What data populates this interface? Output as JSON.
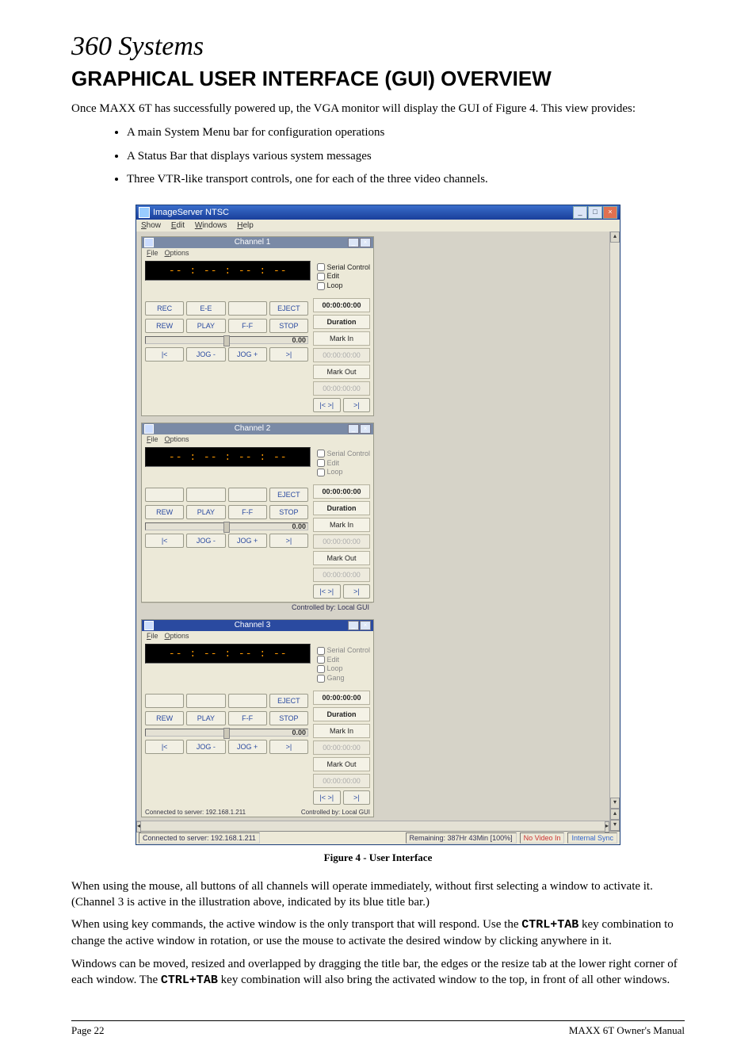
{
  "logo_text": "360 Systems",
  "heading": "GRAPHICAL USER INTERFACE (GUI) OVERVIEW",
  "intro": "Once MAXX 6T has successfully powered up, the VGA monitor will display the GUI of Figure 4. This view provides:",
  "bullets": [
    "A main System Menu bar for configuration operations",
    "A Status Bar that displays various system messages",
    "Three VTR-like transport controls, one for each of the three video channels."
  ],
  "figure_caption": "Figure 4 - User Interface",
  "para2": "When using the mouse, all buttons of all channels will operate immediately, without first selecting a window to activate it. (Channel 3 is active in the illustration above, indicated by its blue title bar.)",
  "para3a": "When using key commands, the active window is the only transport that will respond.  Use the ",
  "para3_key": "CTRL+TAB",
  "para3b": " key combination to change the active window in rotation, or use the mouse to activate the desired window by clicking anywhere in it.",
  "para4a": "Windows can be moved, resized and overlapped by dragging the title bar, the edges or the resize tab at the lower right corner of each window.  The ",
  "para4_key": "CTRL+TAB",
  "para4b": " key combination will also bring the activated window to the top, in front of all other windows.",
  "footer_left": "Page 22",
  "footer_right": "MAXX 6T Owner's Manual",
  "gui": {
    "app_title": "ImageServer NTSC",
    "menus": [
      "Show",
      "Edit",
      "Windows",
      "Help"
    ],
    "status_connected": "Connected to server: 192.168.1.211",
    "status_controlled": "Controlled by: Local GUI",
    "bottom": {
      "server": "Connected to server: 192.168.1.211",
      "remaining": "Remaining: 387Hr 43Min  [100%]",
      "video": "No Video In",
      "sync": "Internal Sync"
    },
    "channels": [
      {
        "title": "Channel  1",
        "active": false,
        "file_menu": [
          "File",
          "Options"
        ],
        "tc": "-- : -- : -- : --",
        "checks_enabled": true,
        "checks": [
          "Serial Control",
          "Edit",
          "Loop"
        ],
        "rows": [
          [
            "REC",
            "E-E",
            "",
            "EJECT"
          ],
          [
            "REW",
            "PLAY",
            "F-F",
            "STOP"
          ],
          [
            "|<",
            "JOG -",
            "JOG +",
            ">|"
          ]
        ],
        "slider_val": "0.00",
        "right": {
          "dur": "00:00:00:00",
          "dur_lbl": "Duration",
          "mark_in": "Mark In",
          "mi_tc": "00:00:00:00",
          "mark_out": "Mark Out",
          "mo_tc": "00:00:00:00",
          "g1": "|< >|",
          "g2": ">|"
        }
      },
      {
        "title": "Channel  2",
        "active": false,
        "file_menu": [
          "File",
          "Options"
        ],
        "tc": "-- : -- : -- : --",
        "checks_enabled": false,
        "checks": [
          "Serial Control",
          "Edit",
          "Loop"
        ],
        "rows": [
          [
            "",
            "",
            "",
            "EJECT"
          ],
          [
            "REW",
            "PLAY",
            "F-F",
            "STOP"
          ],
          [
            "|<",
            "JOG -",
            "JOG +",
            ">|"
          ]
        ],
        "slider_val": "0.00",
        "right": {
          "dur": "00:00:00:00",
          "dur_lbl": "Duration",
          "mark_in": "Mark In",
          "mi_tc": "00:00:00:00",
          "mark_out": "Mark Out",
          "mo_tc": "00:00:00:00",
          "g1": "|< >|",
          "g2": ">|"
        },
        "ctl_by": "Controlled by: Local GUI"
      },
      {
        "title": "Channel  3",
        "active": true,
        "file_menu": [
          "File",
          "Options"
        ],
        "tc": "-- : -- : -- : --",
        "checks_enabled": false,
        "checks": [
          "Serial Control",
          "Edit",
          "Loop",
          "Gang"
        ],
        "rows": [
          [
            "",
            "",
            "",
            "EJECT"
          ],
          [
            "REW",
            "PLAY",
            "F-F",
            "STOP"
          ],
          [
            "|<",
            "JOG -",
            "JOG +",
            ">|"
          ]
        ],
        "slider_val": "0.00",
        "right": {
          "dur": "00:00:00:00",
          "dur_lbl": "Duration",
          "mark_in": "Mark In",
          "mi_tc": "00:00:00:00",
          "mark_out": "Mark Out",
          "mo_tc": "00:00:00:00",
          "g1": "|< >|",
          "g2": ">|"
        }
      }
    ]
  }
}
